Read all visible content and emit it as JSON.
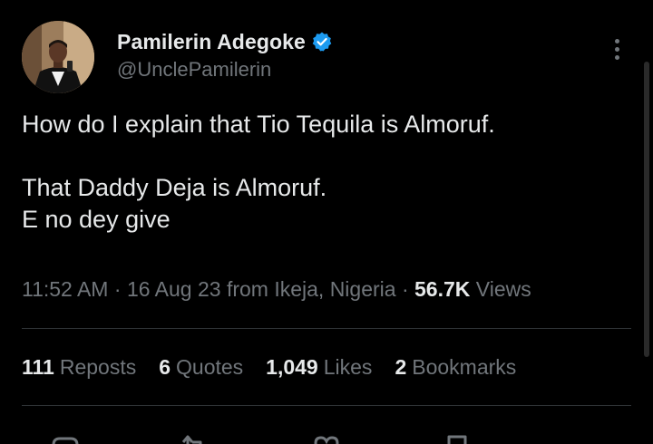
{
  "author": {
    "display_name": "Pamilerin Adegoke",
    "handle": "@UnclePamilerin",
    "verified": true
  },
  "tweet": {
    "lines": [
      "How do I explain that Tio Tequila is Almoruf.",
      "That Daddy Deja is Almoruf.",
      "E no dey give"
    ]
  },
  "meta": {
    "time": "11:52 AM",
    "sep1": "·",
    "date": "16 Aug 23",
    "location": "from Ikeja, Nigeria",
    "sep2": "·",
    "views_count": "56.7K",
    "views_label": "Views"
  },
  "stats": {
    "reposts": {
      "count": "111",
      "label": "Reposts"
    },
    "quotes": {
      "count": "6",
      "label": "Quotes"
    },
    "likes": {
      "count": "1,049",
      "label": "Likes"
    },
    "bookmarks": {
      "count": "2",
      "label": "Bookmarks"
    }
  },
  "icons": {
    "more": "more-options-icon",
    "verified": "verified-badge-icon",
    "reply": "reply-icon",
    "repost": "repost-icon",
    "like": "like-icon",
    "bookmark": "bookmark-icon"
  },
  "colors": {
    "background": "#000000",
    "text_primary": "#e7e9ea",
    "text_secondary": "#71767b",
    "verified_blue": "#1d9bf0",
    "divider": "#2f3336"
  }
}
